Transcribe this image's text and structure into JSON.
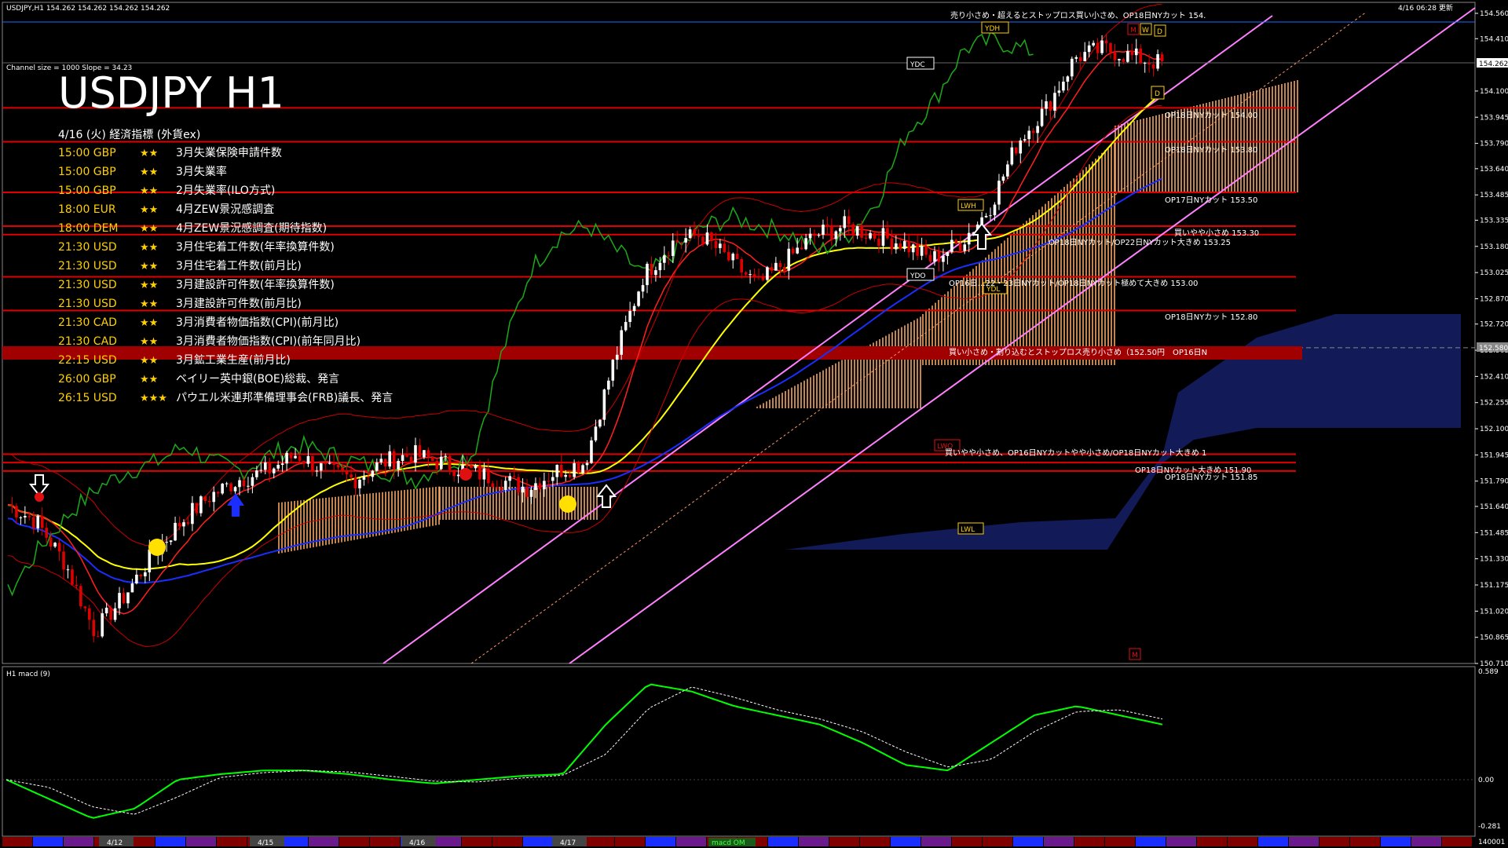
{
  "window_title": "USDJPY,H1  154.262 154.262 154.262 154.262",
  "update_time": "4/16 06:28 更新",
  "channel_info": "Channel size = 1000 Slope = 34.23",
  "big_title": "USDJPY H1",
  "events_header": "4/16 (火) 経済指標 (外貨ex)",
  "events": [
    {
      "time": "15:00",
      "cur": "GBP",
      "stars": "★★",
      "name": "3月失業保険申請件数",
      "hi": false
    },
    {
      "time": "15:00",
      "cur": "GBP",
      "stars": "★★",
      "name": "3月失業率",
      "hi": false
    },
    {
      "time": "15:00",
      "cur": "GBP",
      "stars": "★★",
      "name": "2月失業率(ILO方式)",
      "hi": false
    },
    {
      "time": "18:00",
      "cur": "EUR",
      "stars": "★★",
      "name": "4月ZEW景況感調査",
      "hi": false
    },
    {
      "time": "18:00",
      "cur": "DEM",
      "stars": "★★",
      "name": "4月ZEW景況感調査(期待指数)",
      "hi": false
    },
    {
      "time": "21:30",
      "cur": "USD",
      "stars": "★★",
      "name": "3月住宅着工件数(年率換算件数)",
      "hi": false
    },
    {
      "time": "21:30",
      "cur": "USD",
      "stars": "★★",
      "name": "3月住宅着工件数(前月比)",
      "hi": false
    },
    {
      "time": "21:30",
      "cur": "USD",
      "stars": "★★",
      "name": "3月建設許可件数(年率換算件数)",
      "hi": false
    },
    {
      "time": "21:30",
      "cur": "USD",
      "stars": "★★",
      "name": "3月建設許可件数(前月比)",
      "hi": false
    },
    {
      "time": "21:30",
      "cur": "CAD",
      "stars": "★★",
      "name": "3月消費者物価指数(CPI)(前月比)",
      "hi": false
    },
    {
      "time": "21:30",
      "cur": "CAD",
      "stars": "★★",
      "name": "3月消費者物価指数(CPI)(前年同月比)",
      "hi": false
    },
    {
      "time": "22:15",
      "cur": "USD",
      "stars": "★★",
      "name": "3月鉱工業生産(前月比)",
      "hi": false
    },
    {
      "time": "26:00",
      "cur": "GBP",
      "stars": "★★",
      "name": "ベイリー英中銀(BOE)総裁、発言",
      "hi": false
    },
    {
      "time": "26:15",
      "cur": "USD",
      "stars": "★★★",
      "name": "パウエル米連邦準備理事会(FRB)議長、発言",
      "hi": true
    }
  ],
  "price_axis": [
    "154.560",
    "154.410",
    "154.100",
    "153.945",
    "153.790",
    "153.640",
    "153.485",
    "153.335",
    "153.180",
    "153.025",
    "152.870",
    "152.720",
    "152.565",
    "152.410",
    "152.255",
    "152.100",
    "151.945",
    "151.790",
    "151.640",
    "151.485",
    "151.330",
    "151.175",
    "151.020",
    "150.865",
    "150.710"
  ],
  "current_price": "154.262",
  "mid_price_label": "152.580",
  "macd_axis": [
    "0.589",
    "0.00",
    "-0.281"
  ],
  "macd_label": "H1  macd (9)",
  "macd_bottom": "140001",
  "dates": [
    "4/12",
    "4/15",
    "4/16",
    "4/17"
  ],
  "macd_tag": "macd OM",
  "markers": {
    "ydh": "YDH",
    "ydc": "YDC",
    "ydo": "YDO",
    "ydl": "YDL",
    "lwh": "LWH",
    "lwl": "LWL",
    "lwo": "LWO",
    "m": "M",
    "w": "W",
    "d": "D"
  },
  "annotations": {
    "top": "売り小さめ・超えるとストップロス買い小さめ、OP18日NYカット 154.",
    "a1": "OP18日NYカット 154.00",
    "a2": "OP18日NYカット 153.80",
    "a3": "OP17日NYカット 153.50",
    "a4": "買いやや小さめ 153.30",
    "a5": "OP18日NYカット/OP22日NYカット大きめ 153.25",
    "a6": "OP16日…22・23日NYカット/OP18日NYカット極めて大きめ 153.00",
    "a7": "OP18日NYカット 152.80",
    "a8": "買い小さめ・割り込むとストップロス売り小さめ（152.50円　OP16日N",
    "a9": "買いやや小さめ、OP16日NYカットやや小さめ/OP18日NYカット大きめ 1",
    "a10": "OP18日NYカット大きめ 151.90",
    "a11": "OP18日NYカット 151.85"
  },
  "colors": {
    "bg": "#000000",
    "level": "#ff0000",
    "band": "#cc0000",
    "channel": "#ff80ff",
    "cloud": "#f4a460",
    "kumo_blue": "#2030a0",
    "ma_yellow": "#ffff00",
    "ma_blue": "#1a2eff",
    "macd": "#00ff00",
    "signal": "#ffffff",
    "text_white": "#ffffff",
    "event_gold": "#ffd000"
  },
  "chart_data": {
    "type": "line",
    "title": "USDJPY H1",
    "ylim": [
      150.71,
      154.56
    ],
    "series": [
      {
        "name": "",
        "values": [
          151.65,
          151.55,
          151.3,
          150.9,
          151.1,
          151.35,
          151.55,
          151.7,
          151.8,
          151.85,
          151.95,
          151.85,
          151.8,
          151.9,
          151.95,
          151.9,
          151.85,
          151.8,
          151.75,
          151.85,
          151.9,
          152.5,
          153.0,
          153.2,
          153.25,
          153.1,
          152.95,
          153.1,
          153.25,
          153.3,
          153.25,
          153.2,
          153.1,
          153.2,
          153.4,
          153.8,
          154.0,
          154.3,
          154.35,
          154.3,
          154.262
        ]
      },
      {
        "name": "macd (9)",
        "values": [
          0.0,
          -0.1,
          -0.2,
          -0.15,
          0.0,
          0.03,
          0.05,
          0.05,
          0.03,
          0.0,
          -0.02,
          0.0,
          0.02,
          0.03,
          0.3,
          0.52,
          0.48,
          0.4,
          0.35,
          0.3,
          0.2,
          0.08,
          0.05,
          0.2,
          0.35,
          0.4,
          0.35,
          0.3
        ]
      }
    ]
  }
}
